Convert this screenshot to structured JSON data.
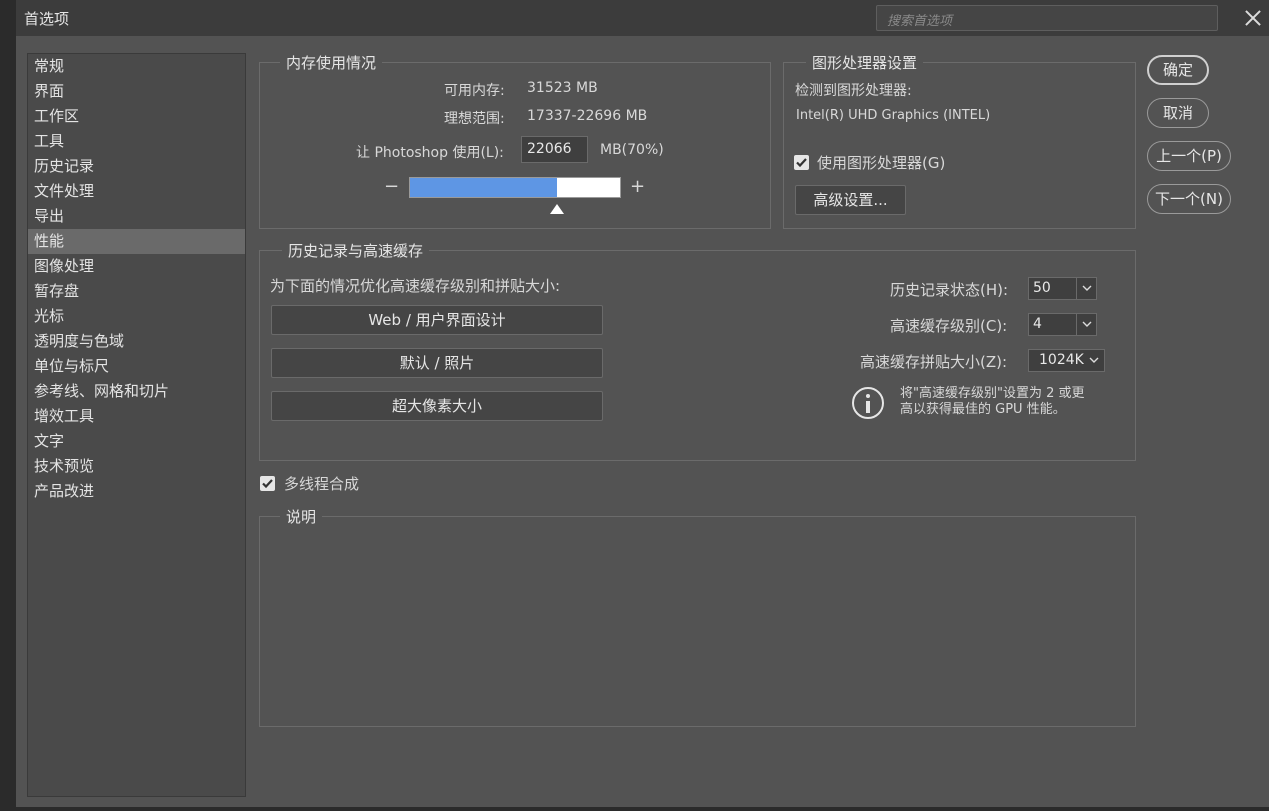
{
  "window": {
    "title": "首选项",
    "search_placeholder": "搜索首选项"
  },
  "sidebar": {
    "items": [
      {
        "label": "常规"
      },
      {
        "label": "界面"
      },
      {
        "label": "工作区"
      },
      {
        "label": "工具"
      },
      {
        "label": "历史记录"
      },
      {
        "label": "文件处理"
      },
      {
        "label": "导出"
      },
      {
        "label": "性能"
      },
      {
        "label": "图像处理"
      },
      {
        "label": "暂存盘"
      },
      {
        "label": "光标"
      },
      {
        "label": "透明度与色域"
      },
      {
        "label": "单位与标尺"
      },
      {
        "label": "参考线、网格和切片"
      },
      {
        "label": "增效工具"
      },
      {
        "label": "文字"
      },
      {
        "label": "技术预览"
      },
      {
        "label": "产品改进"
      }
    ],
    "selected": "性能"
  },
  "memory": {
    "legend": "内存使用情况",
    "available_label": "可用内存:",
    "available_value": "31523 MB",
    "ideal_label": "理想范围:",
    "ideal_value": "17337-22696 MB",
    "use_label": "让 Photoshop 使用(L):",
    "use_value": "22066",
    "use_unit": "MB(70%)",
    "minus": "−",
    "plus": "+",
    "slider_percent": 70
  },
  "gpu": {
    "legend": "图形处理器设置",
    "detected_label": "检测到图形处理器:",
    "gpu_name": "Intel(R) UHD Graphics (INTEL)",
    "use_gpu_label": "使用图形处理器(G)",
    "use_gpu_checked": true,
    "advanced_button": "高级设置..."
  },
  "cache": {
    "legend": "历史记录与高速缓存",
    "optimize_label": "为下面的情况优化高速缓存级别和拼贴大小:",
    "buttons": [
      "Web / 用户界面设计",
      "默认 / 照片",
      "超大像素大小"
    ],
    "history_states_label": "历史记录状态(H):",
    "history_states_value": "50",
    "cache_levels_label": "高速缓存级别(C):",
    "cache_levels_value": "4",
    "tile_size_label": "高速缓存拼贴大小(Z):",
    "tile_size_value": "1024K",
    "info_line1": "将\"高速缓存级别\"设置为 2 或更",
    "info_line2": "高以获得最佳的 GPU 性能。"
  },
  "multithread": {
    "label": "多线程合成",
    "checked": true
  },
  "description": {
    "legend": "说明"
  },
  "actions": {
    "ok": "确定",
    "cancel": "取消",
    "prev": "上一个(P)",
    "next": "下一个(N)"
  }
}
